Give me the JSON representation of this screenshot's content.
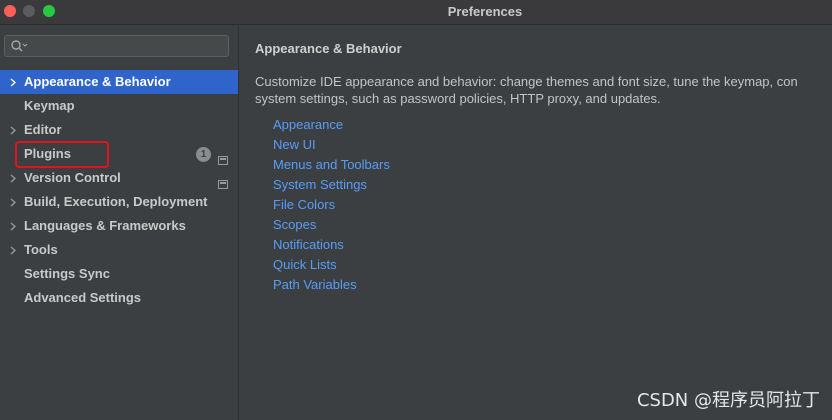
{
  "window": {
    "title": "Preferences"
  },
  "search": {
    "placeholder": ""
  },
  "sidebar": {
    "items": [
      {
        "label": "Appearance & Behavior",
        "expandable": true,
        "selected": true
      },
      {
        "label": "Keymap",
        "expandable": false
      },
      {
        "label": "Editor",
        "expandable": true
      },
      {
        "label": "Plugins",
        "expandable": false,
        "badge": "1",
        "project_icon": true
      },
      {
        "label": "Version Control",
        "expandable": true,
        "project_icon": true
      },
      {
        "label": "Build, Execution, Deployment",
        "expandable": true
      },
      {
        "label": "Languages & Frameworks",
        "expandable": true
      },
      {
        "label": "Tools",
        "expandable": true
      },
      {
        "label": "Settings Sync",
        "expandable": false
      },
      {
        "label": "Advanced Settings",
        "expandable": false
      }
    ]
  },
  "content": {
    "title": "Appearance & Behavior",
    "description_line1": "Customize IDE appearance and behavior: change themes and font size, tune the keymap, con",
    "description_line2": "system settings, such as password policies, HTTP proxy, and updates.",
    "links": [
      "Appearance",
      "New UI",
      "Menus and Toolbars",
      "System Settings",
      "File Colors",
      "Scopes",
      "Notifications",
      "Quick Lists",
      "Path Variables"
    ]
  },
  "watermark": "CSDN @程序员阿拉丁",
  "colors": {
    "selection": "#2f65ca",
    "link": "#589df6",
    "highlight_border": "#e0131e",
    "background": "#3c3f41"
  }
}
